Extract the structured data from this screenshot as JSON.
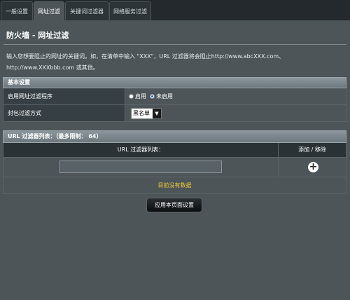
{
  "tabs": [
    {
      "label": "一般设置",
      "active": false
    },
    {
      "label": "网址过滤",
      "active": true
    },
    {
      "label": "关键词过滤器",
      "active": false
    },
    {
      "label": "网络服务过滤",
      "active": false
    }
  ],
  "page": {
    "title": "防火墙 - 网址过滤",
    "description_line1": "输入您想要阻止的网址的关键词。如，在清单中输入 \"XXX\"，URL 过滤器将会阻止http://www.abcXXX.com、",
    "description_line2": "http://www.XXXbbb.com 或其他。"
  },
  "basic": {
    "header": "基本设置",
    "enable": {
      "label": "启用网址过滤程序",
      "option_on": "启用",
      "option_off": "未启用",
      "selected": "未启用"
    },
    "mode": {
      "label": "封包过滤方式",
      "value": "黑名单"
    }
  },
  "url_list": {
    "header": "URL 过滤器列表：（最多限制： 64）",
    "col_list": "URL 过滤器列表：",
    "col_action": "添加 / 移除",
    "input_value": "",
    "add_symbol": "+",
    "empty_text": "目前没有数据"
  },
  "apply_button": "应用本页面设置",
  "colors": {
    "background": "#4d5559",
    "label_cell": "#363f43",
    "section_header": "#7c888d",
    "empty_text": "#f0c93a"
  }
}
